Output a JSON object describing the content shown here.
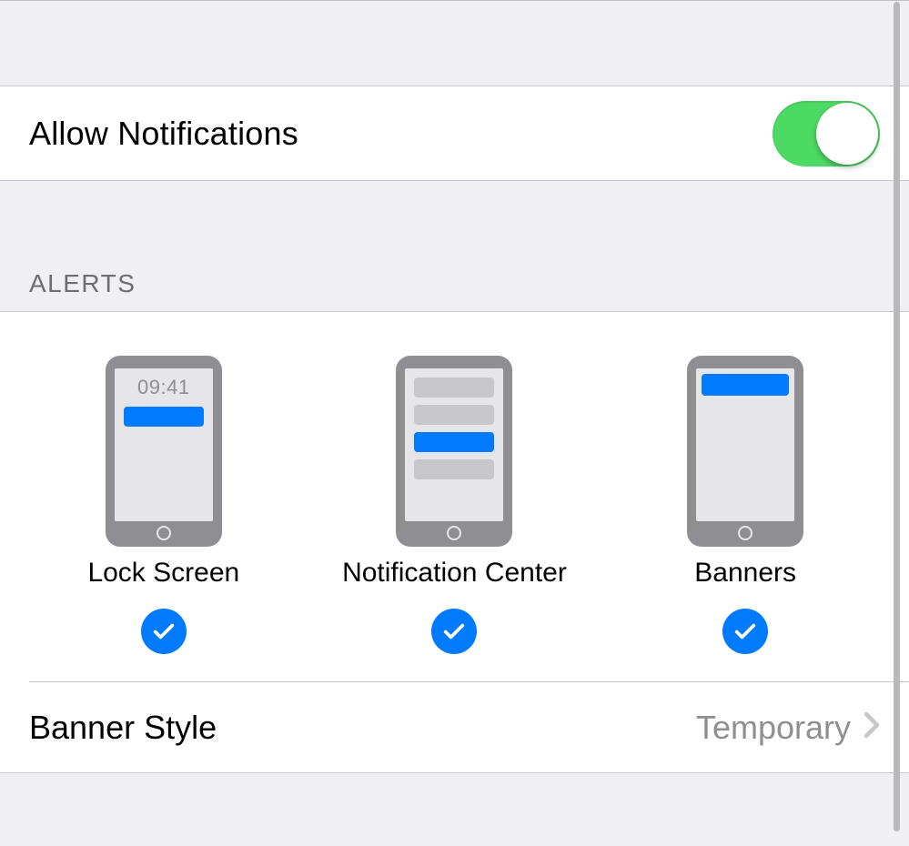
{
  "allow": {
    "label": "Allow Notifications",
    "enabled": true
  },
  "sections": {
    "alerts_header": "ALERTS"
  },
  "alerts": {
    "lock_screen": {
      "label": "Lock Screen",
      "checked": true,
      "icon_time": "09:41"
    },
    "notification_center": {
      "label": "Notification Center",
      "checked": true
    },
    "banners": {
      "label": "Banners",
      "checked": true
    }
  },
  "banner_style": {
    "label": "Banner Style",
    "value": "Temporary"
  },
  "colors": {
    "accent": "#007aff",
    "toggle_on": "#4cd964",
    "bg": "#efeff4",
    "gray": "#8e8e93",
    "separator": "#c8c7cc"
  }
}
